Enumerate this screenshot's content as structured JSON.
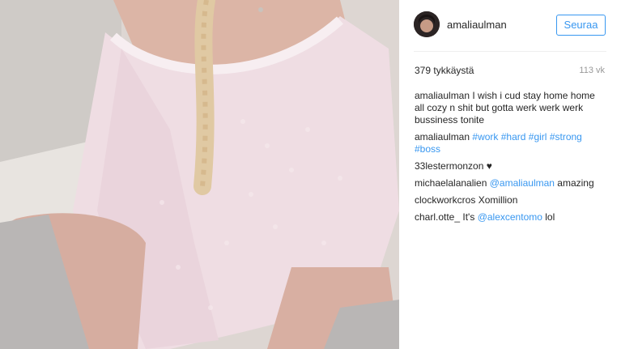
{
  "post": {
    "username": "amaliaulman",
    "follow_label": "Seuraa",
    "likes": "379 tykkäystä",
    "age": "113 vk"
  },
  "comments": [
    {
      "user": "amaliaulman",
      "text": " I wish i cud stay home home all cozy n shit but gotta werk werk werk bussiness tonite"
    },
    {
      "user": "amaliaulman",
      "text": " ",
      "tags": [
        "#work",
        "#hard",
        "#girl",
        "#strong",
        "#boss"
      ]
    },
    {
      "user": "33lestermonzon",
      "text": " ",
      "suffix": "♥"
    },
    {
      "user": "michaelalanalien",
      "text": " ",
      "mention": "@amaliaulman",
      "after": " amazing"
    },
    {
      "user": "clockworkcros",
      "text": " Xomillion"
    },
    {
      "user": "charl.otte_",
      "text": " It's ",
      "mention": "@alexcentomo",
      "after": " lol"
    }
  ],
  "colors": {
    "link": "#3897f0",
    "text": "#262626",
    "muted": "#999999",
    "sweater": "#efdde3"
  },
  "icons": [
    "heart-icon"
  ]
}
